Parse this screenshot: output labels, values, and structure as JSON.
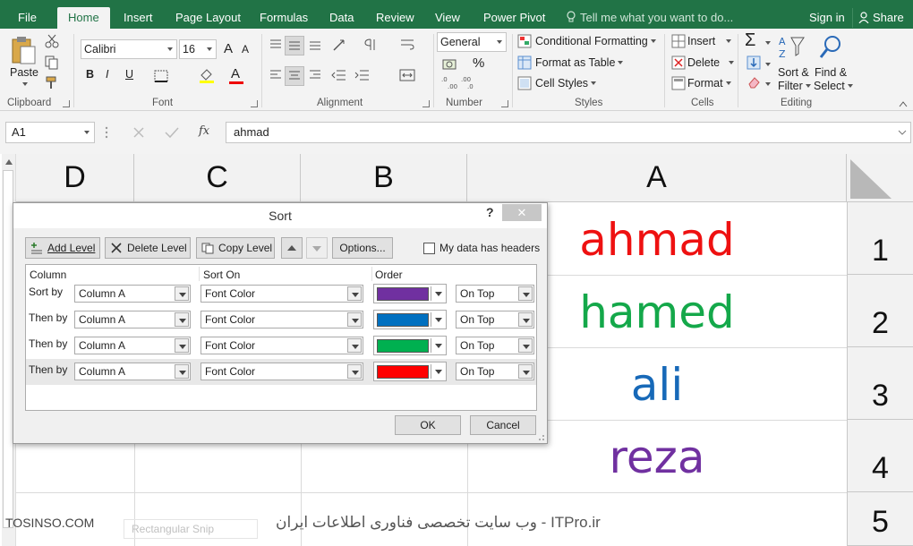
{
  "tabs": [
    {
      "label": "File",
      "active": false
    },
    {
      "label": "Home",
      "active": true
    },
    {
      "label": "Insert",
      "active": false
    },
    {
      "label": "Page Layout",
      "active": false
    },
    {
      "label": "Formulas",
      "active": false
    },
    {
      "label": "Data",
      "active": false
    },
    {
      "label": "Review",
      "active": false
    },
    {
      "label": "View",
      "active": false
    },
    {
      "label": "Power Pivot",
      "active": false
    }
  ],
  "tell_me": "Tell me what you want to do...",
  "sign_in": "Sign in",
  "share": "Share",
  "ribbon": {
    "clipboard": {
      "paste": "Paste",
      "label": "Clipboard"
    },
    "font": {
      "name": "Calibri",
      "size": "16",
      "label": "Font",
      "bold": "B",
      "italic": "I",
      "underline": "U",
      "grow": "A",
      "font_color": "A"
    },
    "alignment": {
      "label": "Alignment"
    },
    "number": {
      "format": "General",
      "percent": "%",
      "label": "Number"
    },
    "styles": {
      "conditional": "Conditional Formatting",
      "format_table": "Format as Table",
      "cell_styles": "Cell Styles",
      "label": "Styles"
    },
    "cells": {
      "insert": "Insert",
      "delete": "Delete",
      "format": "Format",
      "label": "Cells"
    },
    "editing": {
      "sort_filter_1": "Sort &",
      "sort_filter_2": "Filter",
      "find_1": "Find &",
      "find_2": "Select",
      "label": "Editing"
    }
  },
  "formula_bar": {
    "name_box": "A1",
    "value": "ahmad",
    "fx": "fx"
  },
  "columns": [
    {
      "letter": "D"
    },
    {
      "letter": "C"
    },
    {
      "letter": "B"
    },
    {
      "letter": "A"
    }
  ],
  "rows": [
    "1",
    "2",
    "3",
    "4",
    "5"
  ],
  "cells": [
    {
      "text": "ahmad",
      "color": "#ee1111"
    },
    {
      "text": "hamed",
      "color": "#14a84a"
    },
    {
      "text": "ali",
      "color": "#1769b8"
    },
    {
      "text": "reza",
      "color": "#7030a0"
    }
  ],
  "watermark": {
    "left": "TOSINSO.COM",
    "snip": "Rectangular Snip",
    "right": "ITPro.ir - وب سایت تخصصی فناوری اطلاعات ایران"
  },
  "dialog": {
    "title": "Sort",
    "help": "?",
    "close": "✕",
    "add_level": "Add Level",
    "delete_level": "Delete Level",
    "copy_level": "Copy Level",
    "options": "Options...",
    "headers_label": "My data has headers",
    "col_headers": {
      "column": "Column",
      "sort_on": "Sort On",
      "order": "Order"
    },
    "levels": [
      {
        "label": "Sort by",
        "column": "Column A",
        "sort_on": "Font Color",
        "color": "#7030a0",
        "position": "On Top"
      },
      {
        "label": "Then by",
        "column": "Column A",
        "sort_on": "Font Color",
        "color": "#0070c0",
        "position": "On Top"
      },
      {
        "label": "Then by",
        "column": "Column A",
        "sort_on": "Font Color",
        "color": "#00b050",
        "position": "On Top"
      },
      {
        "label": "Then by",
        "column": "Column A",
        "sort_on": "Font Color",
        "color": "#ff0000",
        "position": "On Top"
      }
    ],
    "ok": "OK",
    "cancel": "Cancel"
  }
}
